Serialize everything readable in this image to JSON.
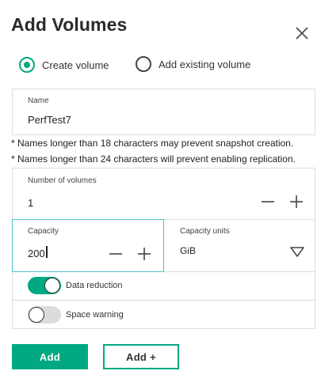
{
  "dialog": {
    "title": "Add Volumes"
  },
  "icons": {
    "close": "close-icon",
    "minus": "minus-icon",
    "plus": "plus-icon",
    "dropdown": "triangle-down-icon"
  },
  "colors": {
    "accent": "#01a982",
    "border": "#dddddd",
    "text": "#333333"
  },
  "mode": {
    "options": [
      {
        "label": "Create volume",
        "selected": true
      },
      {
        "label": "Add existing volume",
        "selected": false
      }
    ]
  },
  "name_field": {
    "label": "Name",
    "value": "PerfTest7"
  },
  "notes": [
    "* Names longer than 18 characters may prevent snapshot creation.",
    "* Names longer than 24 characters will prevent enabling replication."
  ],
  "number_field": {
    "label": "Number of volumes",
    "value": "1"
  },
  "capacity_field": {
    "label": "Capacity",
    "value": "200"
  },
  "units_field": {
    "label": "Capacity units",
    "value": "GiB"
  },
  "toggles": {
    "data_reduction": {
      "label": "Data reduction",
      "on": true
    },
    "space_warning": {
      "label": "Space warning",
      "on": false
    }
  },
  "buttons": {
    "add": "Add",
    "add_plus": "Add +"
  }
}
